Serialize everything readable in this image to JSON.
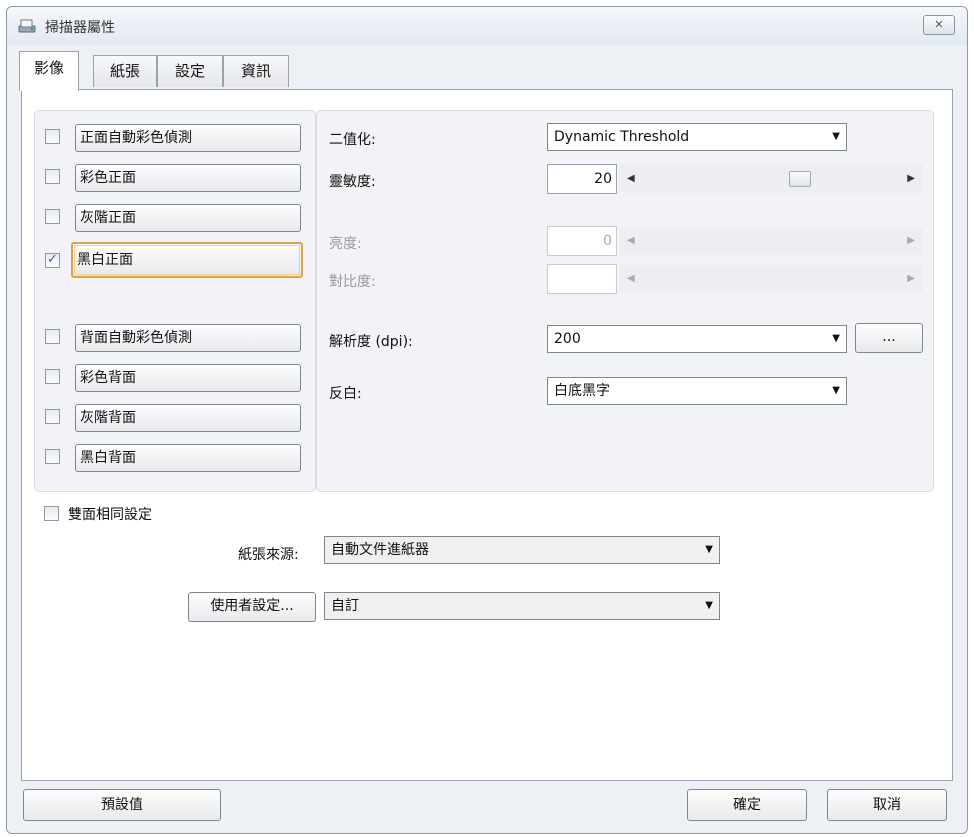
{
  "window": {
    "title": "掃描器屬性",
    "close_label": "✕"
  },
  "tabs": [
    {
      "label": "影像",
      "active": true
    },
    {
      "label": "紙張",
      "active": false
    },
    {
      "label": "設定",
      "active": false
    },
    {
      "label": "資訊",
      "active": false
    }
  ],
  "image_types": {
    "front": [
      {
        "label": "正面自動彩色偵測",
        "checked": false
      },
      {
        "label": "彩色正面",
        "checked": false
      },
      {
        "label": "灰階正面",
        "checked": false
      },
      {
        "label": "黑白正面",
        "checked": true
      }
    ],
    "back": [
      {
        "label": "背面自動彩色偵測",
        "checked": false
      },
      {
        "label": "彩色背面",
        "checked": false
      },
      {
        "label": "灰階背面",
        "checked": false
      },
      {
        "label": "黑白背面",
        "checked": false
      }
    ]
  },
  "settings": {
    "binarization": {
      "label": "二值化:",
      "value": "Dynamic Threshold"
    },
    "sensitivity": {
      "label": "靈敏度:",
      "value": "20"
    },
    "brightness": {
      "label": "亮度:",
      "value": "0"
    },
    "contrast": {
      "label": "對比度:",
      "value": ""
    },
    "resolution": {
      "label": "解析度 (dpi):",
      "value": "200",
      "more_label": "..."
    },
    "bw": {
      "label": "反白:",
      "value": "白底黑字"
    }
  },
  "duplex": {
    "label": "雙面相同設定",
    "checked": false
  },
  "paper_source": {
    "label": "紙張來源:",
    "value": "自動文件進紙器"
  },
  "user_settings": {
    "button_label": "使用者設定...",
    "value": "自訂"
  },
  "footer": {
    "default_label": "預設值",
    "ok_label": "確定",
    "cancel_label": "取消"
  },
  "colors": {
    "focus_ring": "#d7a64a",
    "check": "#3a5e99"
  },
  "sensitivity_slider_level": 0.6
}
